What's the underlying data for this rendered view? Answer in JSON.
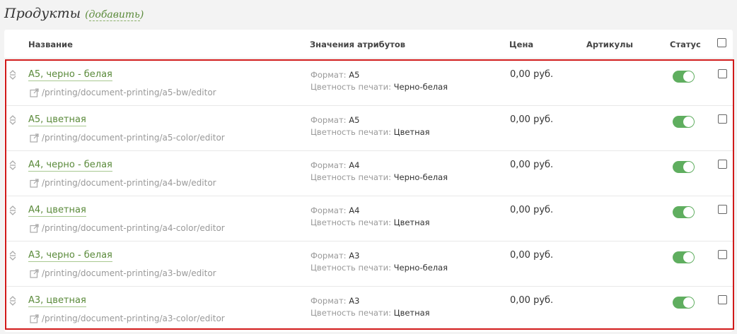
{
  "header": {
    "title": "Продукты",
    "add_label": "добавить"
  },
  "table": {
    "columns": {
      "name": "Название",
      "attrs": "Значения атрибутов",
      "price": "Цена",
      "sku": "Артикулы",
      "status": "Статус"
    },
    "rows": [
      {
        "name": "А5, черно - белая",
        "url": "/printing/document-printing/a5-bw/editor",
        "format_label": "Формат:",
        "format": "А5",
        "color_label": "Цветность печати:",
        "color": "Черно-белая",
        "price": "0,00 руб.",
        "status_on": true
      },
      {
        "name": "А5, цветная",
        "url": "/printing/document-printing/a5-color/editor",
        "format_label": "Формат:",
        "format": "А5",
        "color_label": "Цветность печати:",
        "color": "Цветная",
        "price": "0,00 руб.",
        "status_on": true
      },
      {
        "name": "А4, черно - белая",
        "url": "/printing/document-printing/a4-bw/editor",
        "format_label": "Формат:",
        "format": "А4",
        "color_label": "Цветность печати:",
        "color": "Черно-белая",
        "price": "0,00 руб.",
        "status_on": true
      },
      {
        "name": "А4, цветная",
        "url": "/printing/document-printing/a4-color/editor",
        "format_label": "Формат:",
        "format": "А4",
        "color_label": "Цветность печати:",
        "color": "Цветная",
        "price": "0,00 руб.",
        "status_on": true
      },
      {
        "name": "А3, черно - белая",
        "url": "/printing/document-printing/a3-bw/editor",
        "format_label": "Формат:",
        "format": "А3",
        "color_label": "Цветность печати:",
        "color": "Черно-белая",
        "price": "0,00 руб.",
        "status_on": true
      },
      {
        "name": "А3, цветная",
        "url": "/printing/document-printing/a3-color/editor",
        "format_label": "Формат:",
        "format": "А3",
        "color_label": "Цветность печати:",
        "color": "Цветная",
        "price": "0,00 руб.",
        "status_on": true
      }
    ]
  },
  "icons": {
    "drag": "drag-handle-icon",
    "external": "external-link-icon"
  },
  "colors": {
    "accent": "#5a8a3a",
    "toggle_on": "#5fae5f",
    "highlight_border": "#d11a1a"
  }
}
